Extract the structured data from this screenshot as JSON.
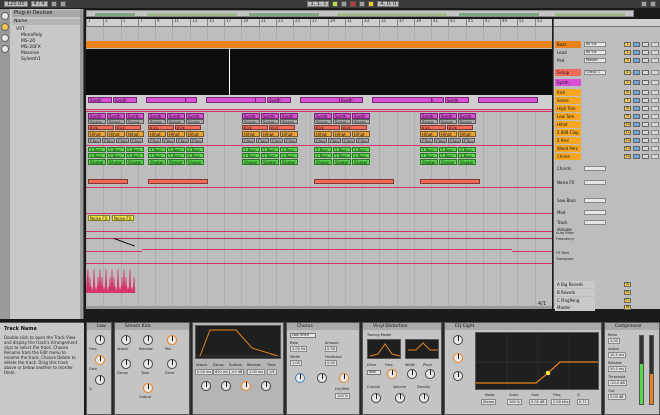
{
  "colors": {
    "orange": "#e8821c",
    "pink": "#d94fd6",
    "salmon": "#f06a5a",
    "yellow_orange": "#f5a623",
    "amber": "#e8a33a",
    "green": "#58d84a",
    "yellow": "#f4e84a",
    "gray_clip": "#a8a8a8",
    "automation": "#d6336c",
    "accent": "#f2c94c",
    "blue_toggle": "#6ea8d8"
  },
  "topbar": {
    "tempo": "120.00",
    "signature": "4 / 4",
    "position": "1. 1. 1",
    "loop_length": "4. 0. 0"
  },
  "browser": {
    "title": "Plug-in Devices",
    "header": "Name",
    "items": [
      "VST",
      "MonoPoly",
      "MS-20",
      "MS-20FX",
      "Massive",
      "Sylenth1"
    ]
  },
  "arrangement": {
    "ruler_labels": [
      "1",
      "3",
      "5",
      "7",
      "9",
      "11",
      "13",
      "15",
      "17",
      "19",
      "21",
      "23",
      "25",
      "27",
      "29",
      "31",
      "33",
      "35",
      "37",
      "39",
      "41",
      "43",
      "45",
      "47",
      "49",
      "51",
      "53"
    ],
    "counter": "4/1",
    "clips": {
      "pink": "Synth",
      "snare": "Snare",
      "kick": "Kick",
      "hihat": "Hihat",
      "clap": "Clap",
      "perc": "1 Perc",
      "shaker": "Shaker",
      "fx": "Noise FX"
    }
  },
  "mixer": {
    "tracks": [
      {
        "name": "Bass",
        "color": "#e8821c",
        "input": "All Ins",
        "num": "1",
        "mode": "Auto"
      },
      {
        "name": "Lead",
        "color": "#bdbdbd",
        "input": "All Ins",
        "num": "2",
        "mode": "Auto"
      },
      {
        "name": "Pad",
        "color": "#bdbdbd",
        "input": "Master",
        "num": "3",
        "mode": "Auto"
      },
      {
        "name": "Group",
        "color": "#f06a5a",
        "input": "Group 1",
        "num": "4",
        "mode": "In"
      },
      {
        "name": "Synth",
        "color": "#d94fd6",
        "input": "",
        "num": "5",
        "mode": ""
      },
      {
        "name": "Kick",
        "color": "#f5a623",
        "input": "",
        "num": "6",
        "mode": ""
      },
      {
        "name": "Snare",
        "color": "#f5a623",
        "input": "",
        "num": "7",
        "mode": ""
      },
      {
        "name": "High Tom",
        "color": "#f5a623",
        "input": "",
        "num": "8",
        "mode": ""
      },
      {
        "name": "Low Tom",
        "color": "#f5a623",
        "input": "",
        "num": "9",
        "mode": ""
      },
      {
        "name": "Hihat",
        "color": "#f5a623",
        "input": "",
        "num": "10",
        "mode": ""
      },
      {
        "name": "2 808 Clap",
        "color": "#f5a623",
        "input": "",
        "num": "11",
        "mode": ""
      },
      {
        "name": "2 Perc",
        "color": "#f5a623",
        "input": "",
        "num": "12",
        "mode": ""
      },
      {
        "name": "Wood Perc",
        "color": "#f5a623",
        "input": "",
        "num": "13",
        "mode": ""
      },
      {
        "name": "Chime",
        "color": "#f5a623",
        "input": "",
        "num": "14",
        "mode": ""
      }
    ],
    "lower_rows": [
      "Chords",
      "Noise FX",
      "Saw Bass",
      "Mod",
      "Track Volume"
    ],
    "automation_labels": [
      "Auto Filter",
      "Frequency",
      "FX Mod",
      "Transpose"
    ],
    "returns": [
      {
        "name": "A Big Reverb",
        "color": "#f5a623",
        "num": "A"
      },
      {
        "name": "B Reverb",
        "color": "#f5a623",
        "num": "B"
      },
      {
        "name": "C PingPong",
        "color": "#f5a623",
        "num": "C"
      },
      {
        "name": "Master",
        "color": "#f5a623",
        "num": "M"
      }
    ]
  },
  "info": {
    "title": "Track Name",
    "text": "Double-click to open the Track View and display the track's Arrangement clips to select the track. Choose Rename from the Edit menu to rename the track. Choose Delete to delete the track. Drag this track above or below another to reorder them."
  },
  "devices": {
    "low": {
      "title": "Low",
      "labels": [
        "Freq",
        "Gain",
        "Q"
      ]
    },
    "smash": {
      "title": "Smash Kick",
      "labels": [
        "Attack",
        "Release",
        "Mix",
        "Decay",
        "Tone",
        "Drive",
        "Output"
      ]
    },
    "envelope": {
      "labels": [
        "Attack",
        "Decay",
        "Sustain",
        "Release",
        "Time"
      ],
      "values": [
        "0.00 ms",
        "600 ms",
        "-inf dB",
        "1.00 ms",
        "1/4"
      ]
    },
    "chorus": {
      "title": "Chorus",
      "labels": [
        "Rate",
        "Amount",
        "Width",
        "Feedback",
        "Dry/Wet"
      ],
      "select": "Low Shelf",
      "values": [
        "4.00 Hz",
        "0.36",
        "1.00",
        "0.00",
        "100 %"
      ]
    },
    "vinyl": {
      "title": "Vinyl Distortion",
      "labels": [
        "Tracing Model",
        "Drive",
        "Freq",
        "Width",
        "Pinch",
        "Crackle",
        "Volume",
        "Density"
      ],
      "mode": "Soft"
    },
    "eq": {
      "title": "EQ Eight",
      "labels": [
        "Mode",
        "Scale",
        "Gain",
        "Freq",
        "Q"
      ],
      "values": [
        "Stereo",
        "100 %",
        "0.00 dB",
        "2.00 kHz",
        "0.71"
      ]
    },
    "compressor": {
      "title": "Compressor",
      "labels": [
        "Ratio",
        "Attack",
        "Release",
        "Threshold",
        "Out"
      ],
      "values": [
        "4.00",
        "10.0 ms",
        "50.0 ms",
        "-20.0 dB",
        "0.00 dB"
      ]
    }
  }
}
